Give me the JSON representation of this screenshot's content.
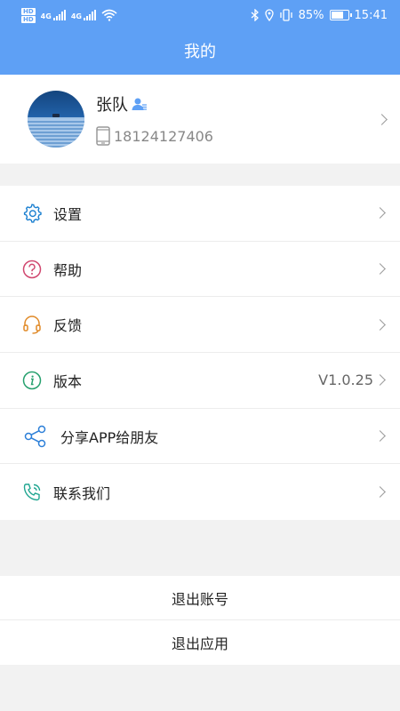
{
  "status_bar": {
    "hd1": "HD",
    "hd2": "HD",
    "net1": "4G",
    "net2": "4G",
    "battery_percent": "85%",
    "battery_level": 0.85,
    "time": "15:41",
    "icons": [
      "bluetooth-icon",
      "location-icon",
      "vibrate-icon",
      "battery-icon",
      "wifi-icon",
      "signal-icon"
    ]
  },
  "header": {
    "title": "我的"
  },
  "profile": {
    "name": "张队",
    "phone": "18124127406",
    "badge_icon": "user-badge-icon",
    "phone_icon": "phone-icon"
  },
  "menu": {
    "items": [
      {
        "key": "settings",
        "label": "设置",
        "icon": "gear-icon",
        "color": "#1a7fd0"
      },
      {
        "key": "help",
        "label": "帮助",
        "icon": "question-icon",
        "color": "#d0476f"
      },
      {
        "key": "feedback",
        "label": "反馈",
        "icon": "headset-icon",
        "color": "#e08a28"
      },
      {
        "key": "version",
        "label": "版本",
        "icon": "info-icon",
        "color": "#26a06e",
        "value": "V1.0.25"
      },
      {
        "key": "share",
        "label": "分享APP给朋友",
        "icon": "share-icon",
        "color": "#2c7fd8"
      },
      {
        "key": "contact",
        "label": "联系我们",
        "icon": "phone-call-icon",
        "color": "#1fa590"
      }
    ]
  },
  "actions": {
    "logout": "退出账号",
    "exit": "退出应用"
  },
  "colors": {
    "accent": "#5ea0f5",
    "background": "#f2f2f2"
  }
}
